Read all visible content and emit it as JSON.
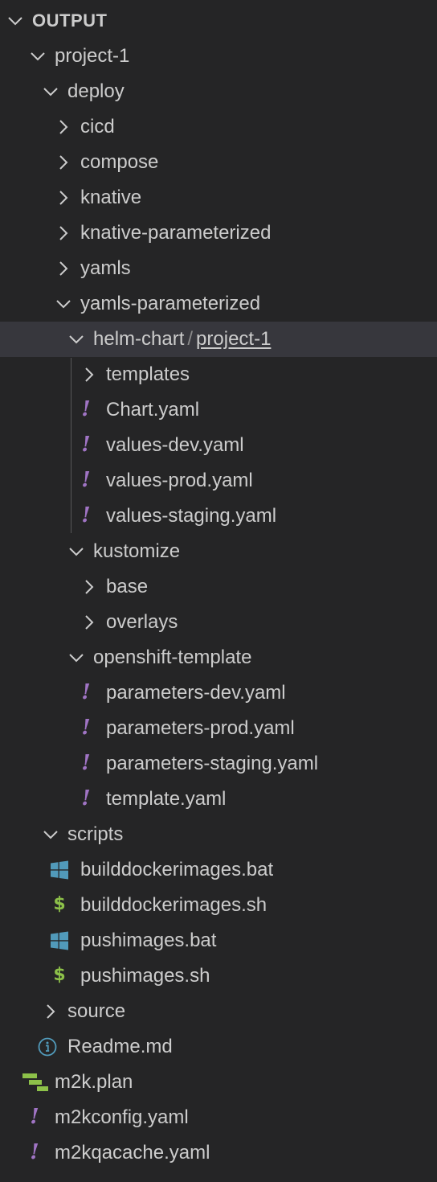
{
  "section": {
    "title": "OUTPUT",
    "icon": "chevron-down-icon"
  },
  "tree": {
    "project": "project-1",
    "deploy": "deploy",
    "cicd": "cicd",
    "compose": "compose",
    "knative": "knative",
    "knative_parameterized": "knative-parameterized",
    "yamls": "yamls",
    "yamls_parameterized": "yamls-parameterized",
    "helm_chart": {
      "first": "helm-chart",
      "separator": "/",
      "second": "project-1"
    },
    "templates": "templates",
    "chart_yaml": "Chart.yaml",
    "values_dev": "values-dev.yaml",
    "values_prod": "values-prod.yaml",
    "values_staging": "values-staging.yaml",
    "kustomize": "kustomize",
    "base": "base",
    "overlays": "overlays",
    "openshift_template": "openshift-template",
    "parameters_dev": "parameters-dev.yaml",
    "parameters_prod": "parameters-prod.yaml",
    "parameters_staging": "parameters-staging.yaml",
    "template_yaml": "template.yaml",
    "scripts": "scripts",
    "builddockerimages_bat": "builddockerimages.bat",
    "builddockerimages_sh": "builddockerimages.sh",
    "pushimages_bat": "pushimages.bat",
    "pushimages_sh": "pushimages.sh",
    "source": "source",
    "readme": "Readme.md",
    "m2k_plan": "m2k.plan",
    "m2kconfig": "m2kconfig.yaml",
    "m2kqacache": "m2kqacache.yaml"
  },
  "icons": {
    "yaml_icon": "!",
    "shell_icon": "$",
    "windows_icon": "windows-icon",
    "info_icon": "info-icon",
    "plan_icon": "plan-icon"
  },
  "colors": {
    "background": "#252526",
    "selected_row": "#37373d",
    "text": "#cccccc",
    "yaml_icon": "#a074c4",
    "shell_icon": "#8dc149",
    "windows_icon": "#519aba",
    "info_icon": "#519aba",
    "plan_icon": "#8dc149"
  }
}
